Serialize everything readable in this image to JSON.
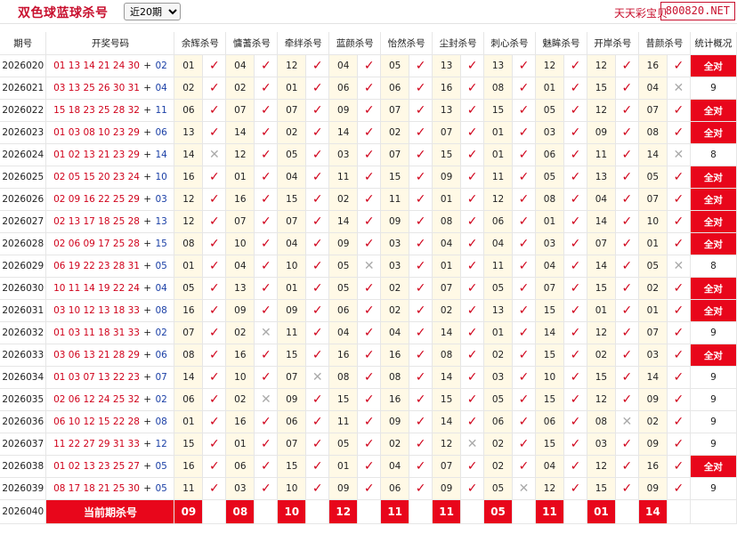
{
  "header": {
    "title": "双色球蓝球杀号",
    "period_select": "近20期",
    "brand_text": "天天彩宝贝",
    "brand_domain": "800820.NET"
  },
  "table": {
    "col_period": "期号",
    "col_draw": "开奖号码",
    "col_stat": "统计概况",
    "experts": [
      "余辉杀号",
      "慵蓍杀号",
      "牵绊杀号",
      "蓝颜杀号",
      "怡然杀号",
      "尘封杀号",
      "刺心杀号",
      "魅眸杀号",
      "开岸杀号",
      "昔颜杀号"
    ],
    "ok_mark": "✓",
    "bad_mark": "✕",
    "rows": [
      {
        "period": "2026020",
        "reds": "01 13 14 21 24 30",
        "plus": "+",
        "blue": "02",
        "picks": [
          "01",
          "04",
          "12",
          "04",
          "05",
          "13",
          "13",
          "12",
          "12",
          "16"
        ],
        "res": [
          1,
          1,
          1,
          1,
          1,
          1,
          1,
          1,
          1,
          1
        ],
        "stat": "全对",
        "all": true
      },
      {
        "period": "2026021",
        "reds": "03 13 25 26 30 31",
        "plus": "+",
        "blue": "04",
        "picks": [
          "02",
          "02",
          "01",
          "06",
          "06",
          "16",
          "08",
          "01",
          "15",
          "04"
        ],
        "res": [
          1,
          1,
          1,
          1,
          1,
          1,
          1,
          1,
          1,
          0
        ],
        "stat": "9",
        "all": false
      },
      {
        "period": "2026022",
        "reds": "15 18 23 25 28 32",
        "plus": "+",
        "blue": "11",
        "picks": [
          "06",
          "07",
          "07",
          "09",
          "07",
          "13",
          "15",
          "05",
          "12",
          "07"
        ],
        "res": [
          1,
          1,
          1,
          1,
          1,
          1,
          1,
          1,
          1,
          1
        ],
        "stat": "全对",
        "all": true
      },
      {
        "period": "2026023",
        "reds": "01 03 08 10 23 29",
        "plus": "+",
        "blue": "06",
        "picks": [
          "13",
          "14",
          "02",
          "14",
          "02",
          "07",
          "01",
          "03",
          "09",
          "08"
        ],
        "res": [
          1,
          1,
          1,
          1,
          1,
          1,
          1,
          1,
          1,
          1
        ],
        "stat": "全对",
        "all": true
      },
      {
        "period": "2026024",
        "reds": "01 02 13 21 23 29",
        "plus": "+",
        "blue": "14",
        "picks": [
          "14",
          "12",
          "05",
          "03",
          "07",
          "15",
          "01",
          "06",
          "11",
          "14"
        ],
        "res": [
          0,
          1,
          1,
          1,
          1,
          1,
          1,
          1,
          1,
          0
        ],
        "stat": "8",
        "all": false
      },
      {
        "period": "2026025",
        "reds": "02 05 15 20 23 24",
        "plus": "+",
        "blue": "10",
        "picks": [
          "16",
          "01",
          "04",
          "11",
          "15",
          "09",
          "11",
          "05",
          "13",
          "05"
        ],
        "res": [
          1,
          1,
          1,
          1,
          1,
          1,
          1,
          1,
          1,
          1
        ],
        "stat": "全对",
        "all": true
      },
      {
        "period": "2026026",
        "reds": "02 09 16 22 25 29",
        "plus": "+",
        "blue": "03",
        "picks": [
          "12",
          "16",
          "15",
          "02",
          "11",
          "01",
          "12",
          "08",
          "04",
          "07"
        ],
        "res": [
          1,
          1,
          1,
          1,
          1,
          1,
          1,
          1,
          1,
          1
        ],
        "stat": "全对",
        "all": true
      },
      {
        "period": "2026027",
        "reds": "02 13 17 18 25 28",
        "plus": "+",
        "blue": "13",
        "picks": [
          "12",
          "07",
          "07",
          "14",
          "09",
          "08",
          "06",
          "01",
          "14",
          "10"
        ],
        "res": [
          1,
          1,
          1,
          1,
          1,
          1,
          1,
          1,
          1,
          1
        ],
        "stat": "全对",
        "all": true
      },
      {
        "period": "2026028",
        "reds": "02 06 09 17 25 28",
        "plus": "+",
        "blue": "15",
        "picks": [
          "08",
          "10",
          "04",
          "09",
          "03",
          "04",
          "04",
          "03",
          "07",
          "01"
        ],
        "res": [
          1,
          1,
          1,
          1,
          1,
          1,
          1,
          1,
          1,
          1
        ],
        "stat": "全对",
        "all": true
      },
      {
        "period": "2026029",
        "reds": "06 19 22 23 28 31",
        "plus": "+",
        "blue": "05",
        "picks": [
          "01",
          "04",
          "10",
          "05",
          "03",
          "01",
          "11",
          "04",
          "14",
          "05"
        ],
        "res": [
          1,
          1,
          1,
          0,
          1,
          1,
          1,
          1,
          1,
          0
        ],
        "stat": "8",
        "all": false
      },
      {
        "period": "2026030",
        "reds": "10 11 14 19 22 24",
        "plus": "+",
        "blue": "04",
        "picks": [
          "05",
          "13",
          "01",
          "05",
          "02",
          "07",
          "05",
          "07",
          "15",
          "02"
        ],
        "res": [
          1,
          1,
          1,
          1,
          1,
          1,
          1,
          1,
          1,
          1
        ],
        "stat": "全对",
        "all": true
      },
      {
        "period": "2026031",
        "reds": "03 10 12 13 18 33",
        "plus": "+",
        "blue": "08",
        "picks": [
          "16",
          "09",
          "09",
          "06",
          "02",
          "02",
          "13",
          "15",
          "01",
          "01"
        ],
        "res": [
          1,
          1,
          1,
          1,
          1,
          1,
          1,
          1,
          1,
          1
        ],
        "stat": "全对",
        "all": true
      },
      {
        "period": "2026032",
        "reds": "01 03 11 18 31 33",
        "plus": "+",
        "blue": "02",
        "picks": [
          "07",
          "02",
          "11",
          "04",
          "04",
          "14",
          "01",
          "14",
          "12",
          "07"
        ],
        "res": [
          1,
          0,
          1,
          1,
          1,
          1,
          1,
          1,
          1,
          1
        ],
        "stat": "9",
        "all": false
      },
      {
        "period": "2026033",
        "reds": "03 06 13 21 28 29",
        "plus": "+",
        "blue": "06",
        "picks": [
          "08",
          "16",
          "15",
          "16",
          "16",
          "08",
          "02",
          "15",
          "02",
          "03"
        ],
        "res": [
          1,
          1,
          1,
          1,
          1,
          1,
          1,
          1,
          1,
          1
        ],
        "stat": "全对",
        "all": true
      },
      {
        "period": "2026034",
        "reds": "01 03 07 13 22 23",
        "plus": "+",
        "blue": "07",
        "picks": [
          "14",
          "10",
          "07",
          "08",
          "08",
          "14",
          "03",
          "10",
          "15",
          "14"
        ],
        "res": [
          1,
          1,
          0,
          1,
          1,
          1,
          1,
          1,
          1,
          1
        ],
        "stat": "9",
        "all": false
      },
      {
        "period": "2026035",
        "reds": "02 06 12 24 25 32",
        "plus": "+",
        "blue": "02",
        "picks": [
          "06",
          "02",
          "09",
          "15",
          "16",
          "15",
          "05",
          "15",
          "12",
          "09"
        ],
        "res": [
          1,
          0,
          1,
          1,
          1,
          1,
          1,
          1,
          1,
          1
        ],
        "stat": "9",
        "all": false
      },
      {
        "period": "2026036",
        "reds": "06 10 12 15 22 28",
        "plus": "+",
        "blue": "08",
        "picks": [
          "01",
          "16",
          "06",
          "11",
          "09",
          "14",
          "06",
          "06",
          "08",
          "02"
        ],
        "res": [
          1,
          1,
          1,
          1,
          1,
          1,
          1,
          1,
          0,
          1
        ],
        "stat": "9",
        "all": false
      },
      {
        "period": "2026037",
        "reds": "11 22 27 29 31 33",
        "plus": "+",
        "blue": "12",
        "picks": [
          "15",
          "01",
          "07",
          "05",
          "02",
          "12",
          "02",
          "15",
          "03",
          "09"
        ],
        "res": [
          1,
          1,
          1,
          1,
          1,
          0,
          1,
          1,
          1,
          1
        ],
        "stat": "9",
        "all": false
      },
      {
        "period": "2026038",
        "reds": "01 02 13 23 25 27",
        "plus": "+",
        "blue": "05",
        "picks": [
          "16",
          "06",
          "15",
          "01",
          "04",
          "07",
          "02",
          "04",
          "12",
          "16"
        ],
        "res": [
          1,
          1,
          1,
          1,
          1,
          1,
          1,
          1,
          1,
          1
        ],
        "stat": "全对",
        "all": true
      },
      {
        "period": "2026039",
        "reds": "08 17 18 21 25 30",
        "plus": "+",
        "blue": "05",
        "picks": [
          "11",
          "03",
          "10",
          "09",
          "06",
          "09",
          "05",
          "12",
          "15",
          "09"
        ],
        "res": [
          1,
          1,
          1,
          1,
          1,
          1,
          0,
          1,
          1,
          1
        ],
        "stat": "9",
        "all": false
      }
    ],
    "current": {
      "period": "2026040",
      "label": "当前期杀号",
      "picks": [
        "09",
        "08",
        "10",
        "12",
        "11",
        "11",
        "05",
        "11",
        "01",
        "14"
      ]
    }
  }
}
